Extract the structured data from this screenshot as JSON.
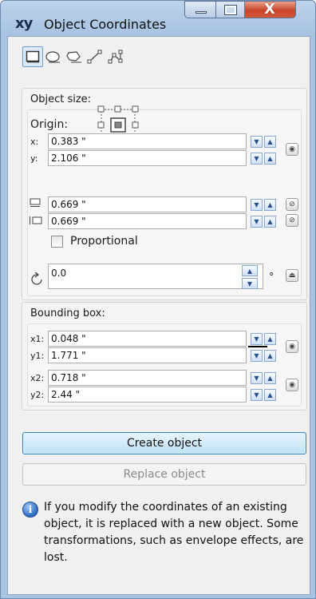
{
  "window": {
    "app_icon_text": "xy",
    "title": "Object Coordinates",
    "minimize_glyph": "",
    "maximize_glyph": "",
    "close_glyph": "X"
  },
  "toolbar": {
    "tools": [
      {
        "icon": "rectangle-tool-icon",
        "active": true
      },
      {
        "icon": "ellipse-tool-icon",
        "active": false
      },
      {
        "icon": "polygon-tool-icon",
        "active": false
      },
      {
        "icon": "line-tool-icon",
        "active": false
      },
      {
        "icon": "polyline-tool-icon",
        "active": false
      }
    ]
  },
  "object_size": {
    "label": "Object size:",
    "origin_label": "Origin:",
    "x_label": "x:",
    "x_value": "0.383 \"",
    "y_label": "y:",
    "y_value": "2.106 \"",
    "width_value": "0.669 \"",
    "height_value": "0.669 \"",
    "proportional_label": "Proportional",
    "proportional_checked": false,
    "rotation_value": "0.0",
    "degree_symbol": "°"
  },
  "bounding_box": {
    "label": "Bounding box:",
    "x1_label": "x1:",
    "x1_value": "0.048 \"",
    "y1_label": "y1:",
    "y1_value": "1.771 \"",
    "x2_label": "x2:",
    "x2_value": "0.718 \"",
    "y2_label": "y2:",
    "y2_value": "2.44 \""
  },
  "buttons": {
    "create_label": "Create object",
    "replace_label": "Replace object"
  },
  "info": {
    "icon_glyph": "i",
    "text": "If you modify the coordinates of an existing object, it is replaced with a new object. Some transformations, such as envelope effects, are lost."
  },
  "colors": {
    "accent_border": "#3c7fb1",
    "spin_arrow": "#2c4f8a",
    "close_button": "#c9442b"
  }
}
